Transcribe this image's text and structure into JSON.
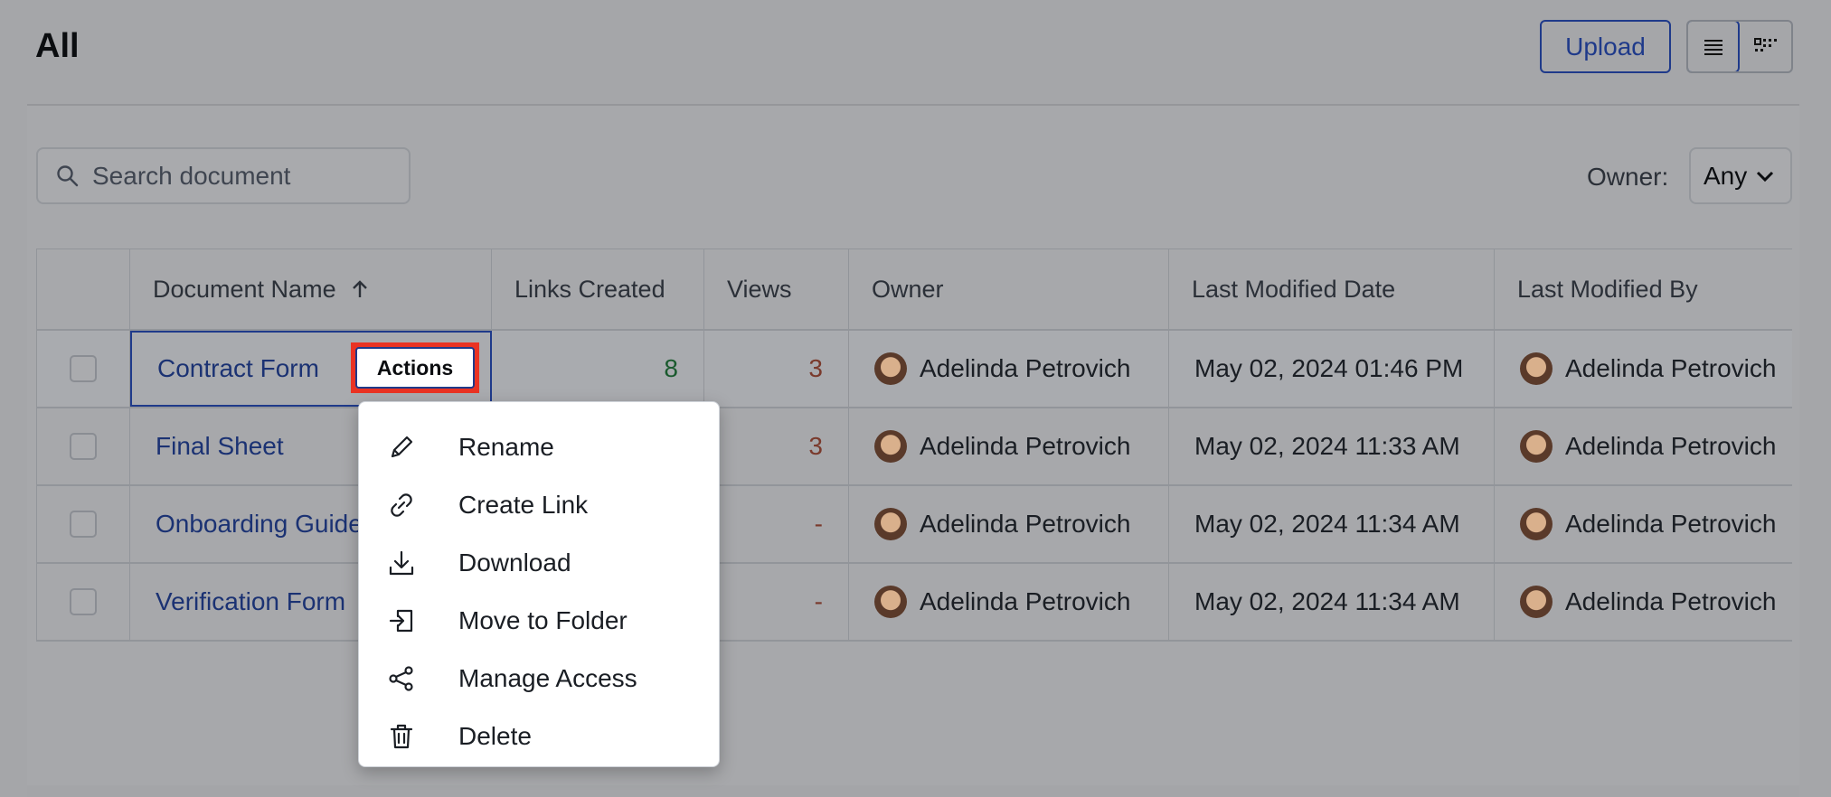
{
  "page": {
    "title": "All"
  },
  "toolbar": {
    "upload_label": "Upload"
  },
  "search": {
    "placeholder": "Search document"
  },
  "filter": {
    "owner_label": "Owner:",
    "owner_value": "Any"
  },
  "table": {
    "columns": [
      "Document Name",
      "Links Created",
      "Views",
      "Owner",
      "Last Modified Date",
      "Last Modified By"
    ],
    "rows": [
      {
        "name": "Contract Form",
        "links": "8",
        "views": "3",
        "owner": "Adelinda Petrovich",
        "modified": "May 02, 2024 01:46 PM",
        "modified_by": "Adelinda Petrovich"
      },
      {
        "name": "Final Sheet",
        "links": "",
        "views": "3",
        "owner": "Adelinda Petrovich",
        "modified": "May 02, 2024 11:33 AM",
        "modified_by": "Adelinda Petrovich"
      },
      {
        "name": "Onboarding Guide",
        "links": "",
        "views": "-",
        "owner": "Adelinda Petrovich",
        "modified": "May 02, 2024 11:34 AM",
        "modified_by": "Adelinda Petrovich"
      },
      {
        "name": "Verification Form",
        "links": "",
        "views": "-",
        "owner": "Adelinda Petrovich",
        "modified": "May 02, 2024 11:34 AM",
        "modified_by": "Adelinda Petrovich"
      }
    ]
  },
  "actions": {
    "button_label": "Actions"
  },
  "menu": {
    "items": [
      {
        "label": "Rename",
        "icon": "pencil-icon"
      },
      {
        "label": "Create Link",
        "icon": "link-icon"
      },
      {
        "label": "Download",
        "icon": "download-icon"
      },
      {
        "label": "Move to Folder",
        "icon": "move-to-folder-icon"
      },
      {
        "label": "Manage Access",
        "icon": "share-icon"
      },
      {
        "label": "Delete",
        "icon": "trash-icon"
      }
    ]
  },
  "colors": {
    "accent": "#1f3a8a",
    "highlight": "#ea3323",
    "positive": "#2e9e4f",
    "negative": "#e8674b"
  }
}
